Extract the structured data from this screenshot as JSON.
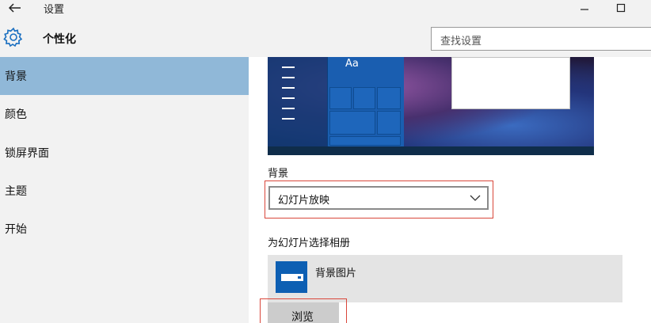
{
  "window": {
    "title": "设置",
    "back_icon": "arrow-left-icon",
    "minimize_icon": "minimize-icon",
    "maximize_icon": "maximize-icon"
  },
  "header": {
    "title": "个性化",
    "icon": "gear-icon",
    "search_placeholder": "查找设置"
  },
  "sidebar": {
    "items": [
      {
        "label": "背景",
        "active": true
      },
      {
        "label": "颜色",
        "active": false
      },
      {
        "label": "锁屏界面",
        "active": false
      },
      {
        "label": "主题",
        "active": false
      },
      {
        "label": "开始",
        "active": false
      }
    ]
  },
  "main": {
    "preview": {
      "tile_label": "Aa"
    },
    "background_label": "背景",
    "background_value": "幻灯片放映",
    "album_label": "为幻灯片选择相册",
    "album_name": "背景图片",
    "browse_label": "浏览"
  },
  "colors": {
    "accent": "#0d5fb3",
    "sidebar_active": "#90b8d8",
    "highlight_box": "#d9463a"
  }
}
